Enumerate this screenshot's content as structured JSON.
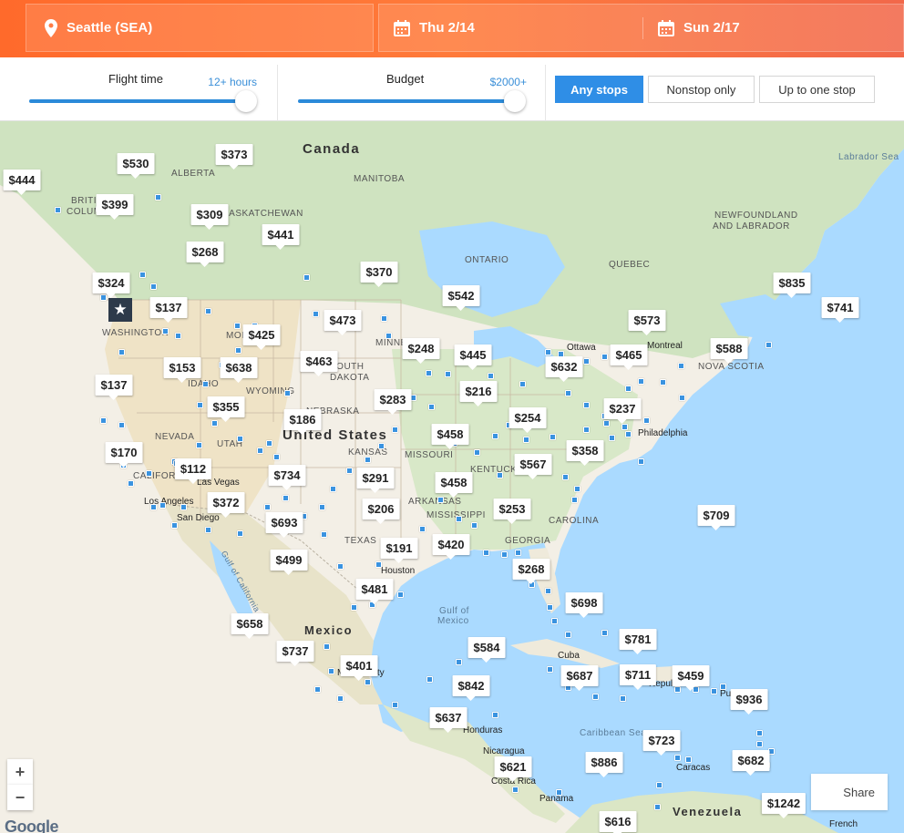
{
  "header": {
    "origin": "Seattle (SEA)",
    "depart_date": "Thu 2/14",
    "return_date": "Sun 2/17"
  },
  "filters": {
    "flight_time_label": "Flight time",
    "flight_time_value": "12+ hours",
    "flight_time_level": 1.0,
    "budget_label": "Budget",
    "budget_value": "$2000+",
    "budget_level": 1.0,
    "stops": [
      {
        "label": "Any stops",
        "active": true
      },
      {
        "label": "Nonstop only",
        "active": false
      },
      {
        "label": "Up to one stop",
        "active": false
      }
    ]
  },
  "map": {
    "country_labels": [
      "Canada",
      "United States",
      "Mexico",
      "Venezuela"
    ],
    "region_labels": [
      "ALBERTA",
      "MANITOBA",
      "SASKATCHEWAN",
      "ONTARIO",
      "QUEBEC",
      "NEWFOUNDLAND",
      "AND LABRADOR",
      "BRITISH",
      "COLUMBIA",
      "WASHINGTON",
      "MONTANA",
      "IDAHO",
      "WYOMING",
      "NEVADA",
      "UTAH",
      "NEBRASKA",
      "KANSAS",
      "MISSOURI",
      "TEXAS",
      "ARKANSAS",
      "MISSISSIPPI",
      "GEORGIA",
      "KENTUCKY",
      "MINNESOTA",
      "SOUTH",
      "DAKOTA",
      "NOVA SCOTIA",
      "CALIFORNIA",
      "CAROLINA"
    ],
    "sea_labels": [
      "Labrador Sea",
      "Gulf of",
      "Mexico",
      "Caribbean Sea",
      "Gulf of California"
    ],
    "city_labels": [
      "Ottawa",
      "Philadelphia",
      "Las Vegas",
      "Los Angeles",
      "San Diego",
      "Houston",
      "Mexico City",
      "Cuba",
      "Honduras",
      "Nicaragua",
      "Costa Rica",
      "Panama",
      "Caracas",
      "French",
      "Montreal",
      "Puerto",
      "Republic"
    ],
    "home_marker": "★",
    "prices": [
      "$444",
      "$530",
      "$373",
      "$399",
      "$309",
      "$268",
      "$441",
      "$324",
      "$370",
      "$542",
      "$137",
      "$473",
      "$425",
      "$573",
      "$835",
      "$741",
      "$153",
      "$638",
      "$463",
      "$248",
      "$445",
      "$465",
      "$588",
      "$137",
      "$355",
      "$632",
      "$283",
      "$216",
      "$237",
      "$186",
      "$254",
      "$458",
      "$170",
      "$358",
      "$112",
      "$734",
      "$291",
      "$567",
      "$458",
      "$372",
      "$206",
      "$253",
      "$709",
      "$693",
      "$191",
      "$420",
      "$499",
      "$268",
      "$481",
      "$698",
      "$658",
      "$737",
      "$584",
      "$781",
      "$401",
      "$842",
      "$687",
      "$711",
      "$459",
      "$936",
      "$637",
      "$723",
      "$886",
      "$682",
      "$621",
      "$1242",
      "$616"
    ],
    "share_label": "Share",
    "zoom_in": "+",
    "zoom_out": "−",
    "attribution": "Google"
  }
}
